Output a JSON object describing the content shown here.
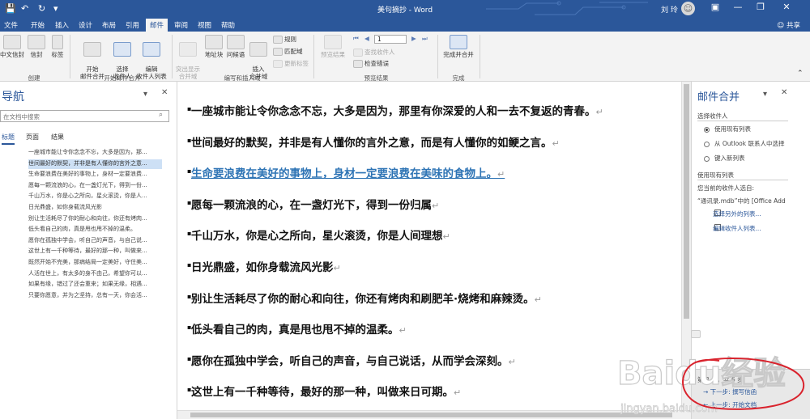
{
  "titlebar": {
    "title": "美句摘抄 - Word",
    "user": "刘 玲",
    "avatar_glyph": "☺",
    "quick_access": [
      "💾",
      "↶",
      "↻",
      "▾"
    ],
    "window_buttons": [
      "▣",
      "—",
      "❐",
      "✕"
    ],
    "color": "#2b579a"
  },
  "tabs": {
    "items": [
      "文件",
      "开始",
      "插入",
      "设计",
      "布局",
      "引用",
      "邮件",
      "审阅",
      "视图",
      "帮助"
    ],
    "active": "邮件",
    "share": "☺ 共享"
  },
  "ribbon": {
    "create": {
      "chinese_envelopes": "中文信封",
      "envelopes": "信封",
      "labels": "标签",
      "group": "创建"
    },
    "start_merge": {
      "start_mail_merge": "开始\n邮件合并",
      "select_recipients": "选择\n收件人",
      "edit_recipient_list": "编辑\n收件人列表",
      "group": "开始邮件合并"
    },
    "write_insert": {
      "highlight_fields": "突出显示\n合并域",
      "address_block": "地址块",
      "greeting_line": "问候语",
      "insert_merge_field": "插入\n合并域",
      "rules": "规则",
      "match_fields": "匹配域",
      "update_labels": "更新标签",
      "group": "编写和插入域"
    },
    "preview": {
      "preview_results": "预览结果",
      "record_value": "1",
      "find_recipient": "查找收件人",
      "check_errors": "检查错误",
      "group": "预览结果"
    },
    "finish": {
      "finish_merge": "完成并合并",
      "group": "完成"
    }
  },
  "nav": {
    "title": "导航",
    "search_placeholder": "在文档中搜索",
    "search_icon": "⌕",
    "tabs": [
      "标题",
      "页面",
      "结果"
    ],
    "headings": [
      "一座城市能让令你念念不忘，大多是因为，那...",
      "世间最好的默契，并非是有人懂你的言外之意...",
      "生命要浪费在美好的事物上，身材一定要浪费...",
      "愿每一颗流浪的心，在一盏灯光下，得到一份...",
      "千山万水，你是心之所向，星火滚烫，你是人...",
      "日光鼎盛，如你身载流风光影",
      "别让生活耗尽了你的耐心和向往，你还有烤肉...",
      "低头看自己的肉，真是甩也甩不掉的温柔。",
      "愿你在孤独中学会，听自己的声音，与自己说...",
      "这世上有一千种等待，最好的那一种，叫做来...",
      "既然开始不完美，那病结局一定美好，守住美...",
      "人活在世上，有太多的身不由己，希望你可以...",
      "如果有缘，错过了还会重来；如果无缘，相遇...",
      "只要你愿意，并为之坚持，总有一天，你会活..."
    ],
    "selected_index": 1
  },
  "document": {
    "paragraph_mark": "↵",
    "paragraphs": [
      "一座城市能让令你念念不忘，大多是因为，那里有你深爱的人和一去不复返的青春。",
      "世间最好的默契，并非是有人懂你的言外之意，而是有人懂你的如鲠之言。",
      "生命要浪费在美好的事物上，身材一定要浪费在美味的食物上。",
      "愿每一颗流浪的心，在一盏灯光下，得到一份归属",
      "千山万水，你是心之所向，星火滚烫，你是人间理想",
      "日光鼎盛，如你身载流风光影",
      "别让生活耗尽了你的耐心和向往，你还有烤肉和刷肥羊·烧烤和麻辣烫。",
      "低头看自己的肉，真是甩也甩不掉的温柔。",
      "愿你在孤独中学会，听自己的声音，与自己说话，从而学会深刻。",
      "这世上有一千种等待，最好的那一种，叫做来日可期。"
    ],
    "link_index": 2,
    "link_color": "#2e74b5"
  },
  "mail_merge": {
    "title": "邮件合并",
    "select_recipients_heading": "选择收件人",
    "options": [
      "使用现有列表",
      "从 Outlook 联系人中选择",
      "键入新列表"
    ],
    "selected_option": 0,
    "use_existing_heading": "使用现有列表",
    "current_from": "您当前的收件人选自:",
    "source": "“通讯录.mdb”中的 [Office Add",
    "links": [
      "选择另外的列表...",
      "编辑收件人列表..."
    ],
    "footer_step": "第 3 步，共 6 步",
    "footer_next": "→ 下一步: 撰写信函",
    "footer_prev": "← 上一步: 开始文档"
  },
  "watermark": {
    "brand": "Baidu经验",
    "url": "jingyan.baidu.com"
  },
  "colors": {
    "accent": "#2b579a",
    "annotation_red": "#d9232d"
  }
}
